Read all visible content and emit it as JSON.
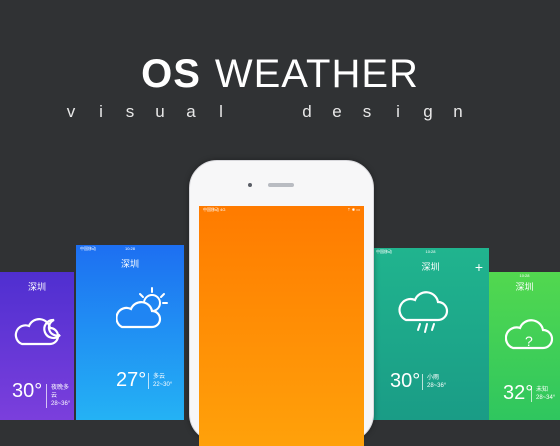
{
  "header": {
    "title_bold": "OS",
    "title_light": "WEATHER",
    "subtitle_letters": [
      "v",
      "i",
      "s",
      "u",
      "a",
      "l",
      "d",
      "e",
      "s",
      "i",
      "g",
      "n"
    ]
  },
  "screens": [
    {
      "city": "深圳",
      "temp": "30°",
      "desc_line1": "夜晚多云",
      "desc_line2": "28~36°",
      "icon": "cloudy-night-icon"
    },
    {
      "carrier": "中国移动",
      "time": "10:28",
      "city": "深圳",
      "temp": "27°",
      "desc_line1": "多云",
      "desc_line2": "22~30°",
      "icon": "partly-cloudy-icon"
    },
    {
      "carrier": "中国移动 4G",
      "status_icons": "⇡ ✱ ▭"
    },
    {
      "carrier": "中国移动",
      "time": "10:28",
      "city": "深圳",
      "temp": "30°",
      "desc_line1": "小雨",
      "desc_line2": "28~36°",
      "icon": "rain-cloud-icon",
      "plus": "+"
    },
    {
      "time": "10:28",
      "city": "深圳",
      "temp": "32°",
      "desc_line1": "未知",
      "desc_line2": "28~34°",
      "icon": "unknown-weather-icon"
    }
  ],
  "colors": {
    "background": "#303234",
    "purple": "#5d37d8",
    "blue": "#1d8ef5",
    "orange": "#ff8d00",
    "teal": "#21b58c",
    "green": "#4bd54c"
  }
}
